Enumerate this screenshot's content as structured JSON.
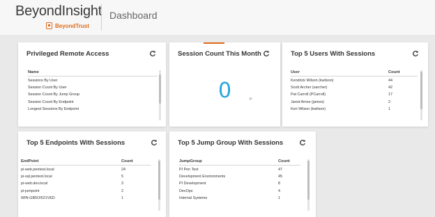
{
  "header": {
    "app_title": "BeyondInsight",
    "vendor": "BeyondTrust",
    "page_title": "Dashboard"
  },
  "widgets": {
    "privileged_remote_access": {
      "title": "Privileged Remote Access",
      "column": "Name",
      "items": [
        "Sessions By User",
        "Session Count By User",
        "Session Count By Jump Group",
        "Session Count By Endpoint",
        "Longest Sessions By Endpoint"
      ]
    },
    "session_count": {
      "title": "Session Count This Month",
      "value": "0"
    },
    "top_users": {
      "title": "Top 5 Users With Sessions",
      "columns": [
        "User",
        "Count"
      ],
      "rows": [
        [
          "Kendrick Wilson (kwilson)",
          "44"
        ],
        [
          "Scott Archer (sarcher)",
          "42"
        ],
        [
          "Pat Carroll (PCarroll)",
          "17"
        ],
        [
          "Jarod Amos (jamos)",
          "2"
        ],
        [
          "Ken Wilson (kwilson)",
          "1"
        ]
      ]
    },
    "top_endpoints": {
      "title": "Top 5 Endpoints With Sessions",
      "columns": [
        "EndPoint",
        "Count"
      ],
      "rows": [
        [
          "pi-web.pentest.local",
          "24"
        ],
        [
          "pi-sql.pentest.local",
          "5"
        ],
        [
          "pi-web.dev.local",
          "3"
        ],
        [
          "pi-jumpoint",
          "2"
        ],
        [
          "WIN-GB5OI521VED",
          "1"
        ]
      ]
    },
    "top_jump_groups": {
      "title": "Top 5 Jump Group With Sessions",
      "columns": [
        "JumpGroup",
        "Count"
      ],
      "rows": [
        [
          "PI Pen Test",
          "47"
        ],
        [
          "Development Environments",
          "45"
        ],
        [
          "PI Development",
          "8"
        ],
        [
          "DevOps",
          "4"
        ],
        [
          "Internal Systems",
          "1"
        ]
      ]
    }
  },
  "colors": {
    "accent": "#e06a1a",
    "count_blue": "#29a6dd"
  },
  "icons": {
    "refresh": "refresh-icon",
    "logo": "beyondtrust-logo-icon"
  }
}
